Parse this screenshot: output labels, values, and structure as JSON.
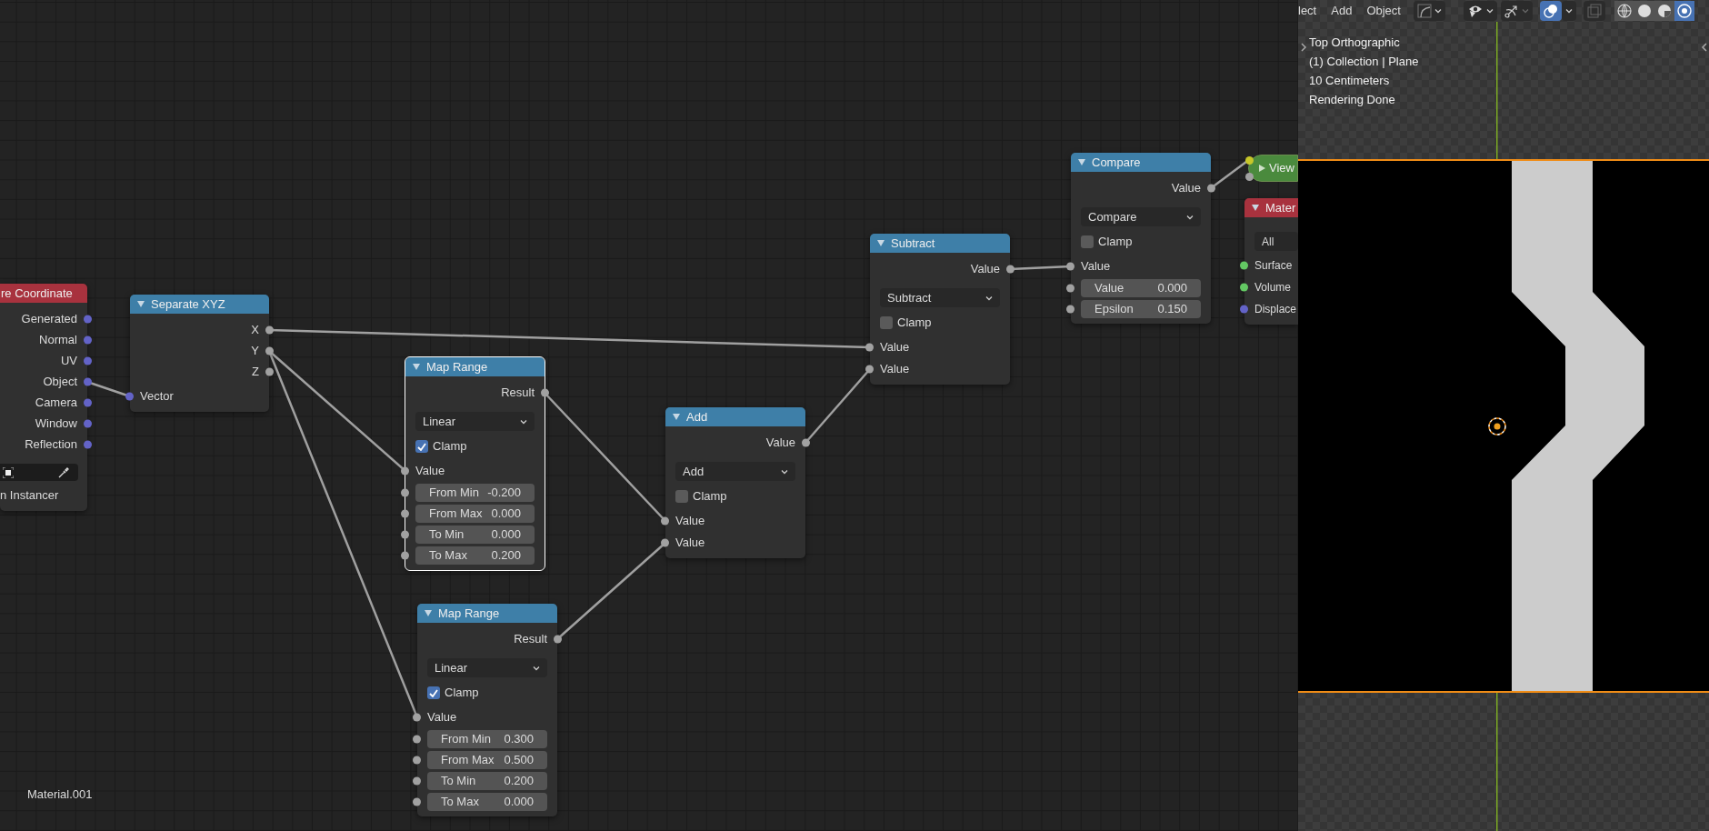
{
  "node_editor": {
    "material_name": "Material.001",
    "nodes": [
      {
        "title": "re Coordinate",
        "color": "#a8323e",
        "selected": false,
        "rows": [
          {
            "kind": "output",
            "label": "Generated",
            "color": "#6363c7"
          },
          {
            "kind": "output",
            "label": "Normal",
            "color": "#6363c7"
          },
          {
            "kind": "output",
            "label": "UV",
            "color": "#6363c7"
          },
          {
            "kind": "output",
            "label": "Object",
            "color": "#6363c7"
          },
          {
            "kind": "output",
            "label": "Camera",
            "color": "#6363c7"
          },
          {
            "kind": "output",
            "label": "Window",
            "color": "#6363c7"
          },
          {
            "kind": "output",
            "label": "Reflection",
            "color": "#6363c7"
          },
          {
            "kind": "object_field"
          },
          {
            "kind": "label",
            "label": "n Instancer"
          }
        ]
      },
      {
        "title": "Separate XYZ",
        "color": "#3e7fa8",
        "expanded": true,
        "selected": false,
        "rows": [
          {
            "kind": "output",
            "label": "X",
            "color": "#a1a1a1"
          },
          {
            "kind": "output",
            "label": "Y",
            "color": "#a1a1a1"
          },
          {
            "kind": "output",
            "label": "Z",
            "color": "#a1a1a1"
          },
          {
            "kind": "input",
            "label": "Vector",
            "color": "#6363c7"
          }
        ]
      },
      {
        "title": "Map Range",
        "color": "#3e7fa8",
        "expanded": true,
        "selected": true,
        "rows": [
          {
            "kind": "output",
            "label": "Result",
            "color": "#a1a1a1"
          },
          {
            "kind": "dropdown",
            "value": "Linear"
          },
          {
            "kind": "checkbox",
            "label": "Clamp",
            "checked": true
          },
          {
            "kind": "input",
            "label": "Value",
            "color": "#a1a1a1"
          },
          {
            "kind": "field",
            "label": "From Min",
            "value": "-0.200",
            "color": "#a1a1a1"
          },
          {
            "kind": "field",
            "label": "From Max",
            "value": "0.000",
            "color": "#a1a1a1"
          },
          {
            "kind": "field",
            "label": "To Min",
            "value": "0.000",
            "color": "#a1a1a1"
          },
          {
            "kind": "field",
            "label": "To Max",
            "value": "0.200",
            "color": "#a1a1a1"
          }
        ]
      },
      {
        "title": "Map Range",
        "color": "#3e7fa8",
        "expanded": true,
        "selected": false,
        "rows": [
          {
            "kind": "output",
            "label": "Result",
            "color": "#a1a1a1"
          },
          {
            "kind": "dropdown",
            "value": "Linear"
          },
          {
            "kind": "checkbox",
            "label": "Clamp",
            "checked": true
          },
          {
            "kind": "input",
            "label": "Value",
            "color": "#a1a1a1"
          },
          {
            "kind": "field",
            "label": "From Min",
            "value": "0.300",
            "color": "#a1a1a1"
          },
          {
            "kind": "field",
            "label": "From Max",
            "value": "0.500",
            "color": "#a1a1a1"
          },
          {
            "kind": "field",
            "label": "To Min",
            "value": "0.200",
            "color": "#a1a1a1"
          },
          {
            "kind": "field",
            "label": "To Max",
            "value": "0.000",
            "color": "#a1a1a1"
          }
        ]
      },
      {
        "title": "Add",
        "color": "#3e7fa8",
        "expanded": true,
        "selected": false,
        "rows": [
          {
            "kind": "output",
            "label": "Value",
            "color": "#a1a1a1"
          },
          {
            "kind": "dropdown",
            "value": "Add"
          },
          {
            "kind": "checkbox",
            "label": "Clamp",
            "checked": false
          },
          {
            "kind": "input",
            "label": "Value",
            "color": "#a1a1a1"
          },
          {
            "kind": "input",
            "label": "Value",
            "color": "#a1a1a1"
          }
        ]
      },
      {
        "title": "Subtract",
        "color": "#3e7fa8",
        "expanded": true,
        "selected": false,
        "rows": [
          {
            "kind": "output",
            "label": "Value",
            "color": "#a1a1a1"
          },
          {
            "kind": "dropdown",
            "value": "Subtract"
          },
          {
            "kind": "checkbox",
            "label": "Clamp",
            "checked": false
          },
          {
            "kind": "input",
            "label": "Value",
            "color": "#a1a1a1"
          },
          {
            "kind": "input",
            "label": "Value",
            "color": "#a1a1a1"
          }
        ]
      },
      {
        "title": "Compare",
        "color": "#3e7fa8",
        "expanded": true,
        "selected": false,
        "rows": [
          {
            "kind": "output",
            "label": "Value",
            "color": "#a1a1a1"
          },
          {
            "kind": "dropdown",
            "value": "Compare"
          },
          {
            "kind": "checkbox",
            "label": "Clamp",
            "checked": false
          },
          {
            "kind": "input",
            "label": "Value",
            "color": "#a1a1a1"
          },
          {
            "kind": "field",
            "label": "Value",
            "value": "0.000",
            "color": "#a1a1a1"
          },
          {
            "kind": "field",
            "label": "Epsilon",
            "value": "0.150",
            "color": "#a1a1a1"
          }
        ]
      },
      {
        "title": "View",
        "color": "#4a8a3d",
        "expanded": false,
        "selected": false,
        "rows": [
          {
            "kind": "input",
            "color": "#c7c729"
          },
          {
            "kind": "input",
            "color": "#a1a1a1"
          }
        ]
      },
      {
        "title": "Mater",
        "color": "#a8323e",
        "expanded": true,
        "selected": false,
        "rows": [
          {
            "kind": "dropdown",
            "value": "All"
          },
          {
            "kind": "input",
            "label": "Surface",
            "color": "#63c763"
          },
          {
            "kind": "input",
            "label": "Volume",
            "color": "#63c763"
          },
          {
            "kind": "input",
            "label": "Displace",
            "color": "#6363c7"
          }
        ]
      }
    ]
  },
  "viewport": {
    "menus": [
      "lect",
      "Add",
      "Object"
    ],
    "overlays_enabled": true,
    "shading_modes": [
      {
        "selected": false
      },
      {
        "selected": false
      },
      {
        "selected": false
      },
      {
        "selected": true
      }
    ],
    "overlay_text": [
      "Top Orthographic",
      "(1) Collection | Plane",
      "10 Centimeters",
      "Rendering Done"
    ]
  }
}
